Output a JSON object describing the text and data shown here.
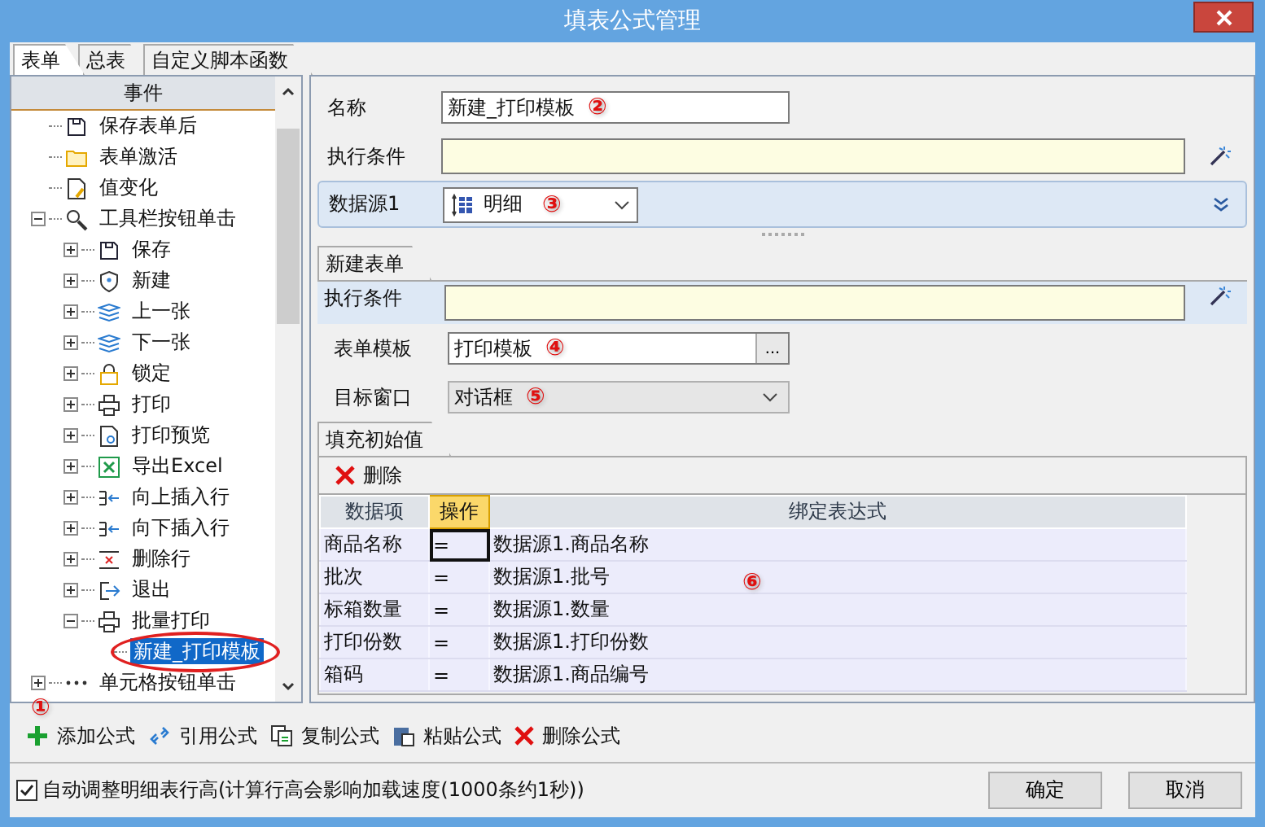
{
  "window": {
    "title": "填表公式管理"
  },
  "tabs": [
    {
      "label": "表单",
      "selected": true
    },
    {
      "label": "总表",
      "selected": false
    },
    {
      "label": "自定义脚本函数",
      "selected": false
    }
  ],
  "tree": {
    "header": "事件",
    "marker": "①",
    "items": [
      {
        "label": "保存表单后",
        "selected": false
      },
      {
        "label": "表单激活",
        "selected": false
      },
      {
        "label": "值变化",
        "selected": false
      },
      {
        "label": "工具栏按钮单击",
        "selected": false,
        "expanded": true,
        "children": [
          {
            "label": "保存",
            "selected": false,
            "expanded": false
          },
          {
            "label": "新建",
            "selected": false,
            "expanded": false
          },
          {
            "label": "上一张",
            "selected": false,
            "expanded": false
          },
          {
            "label": "下一张",
            "selected": false,
            "expanded": false
          },
          {
            "label": "锁定",
            "selected": false,
            "expanded": false
          },
          {
            "label": "打印",
            "selected": false,
            "expanded": false
          },
          {
            "label": "打印预览",
            "selected": false,
            "expanded": false
          },
          {
            "label": "导出Excel",
            "selected": false,
            "expanded": false
          },
          {
            "label": "向上插入行",
            "selected": false,
            "expanded": false
          },
          {
            "label": "向下插入行",
            "selected": false,
            "expanded": false
          },
          {
            "label": "删除行",
            "selected": false,
            "expanded": false
          },
          {
            "label": "退出",
            "selected": false,
            "expanded": false
          },
          {
            "label": "批量打印",
            "selected": false,
            "expanded": true,
            "children": [
              {
                "label": "新建_打印模板",
                "selected": true,
                "circled": true
              }
            ]
          }
        ]
      },
      {
        "label": "单元格按钮单击",
        "selected": false,
        "expanded": false
      }
    ]
  },
  "form": {
    "name": {
      "label": "名称",
      "value": "新建_打印模板",
      "marker": "②"
    },
    "condition": {
      "label": "执行条件"
    },
    "datasource": {
      "label": "数据源1",
      "value": "明细",
      "marker": "③"
    }
  },
  "subtab": {
    "label": "新建表单",
    "condition": {
      "label": "执行条件"
    },
    "template": {
      "label": "表单模板",
      "value": "打印模板",
      "button": "...",
      "marker": "④"
    },
    "target": {
      "label": "目标窗口",
      "value": "对话框",
      "marker": "⑤"
    }
  },
  "fill": {
    "tab": "填充初始值",
    "delete": "删除",
    "marker": "⑥",
    "columns": [
      {
        "label": "数据项",
        "selected": false
      },
      {
        "label": "操作",
        "selected": true
      },
      {
        "label": "绑定表达式",
        "selected": false
      }
    ],
    "rows": [
      [
        "商品名称",
        "=",
        "数据源1.商品名称"
      ],
      [
        "批次",
        "=",
        "数据源1.批号"
      ],
      [
        "标箱数量",
        "=",
        "数据源1.数量"
      ],
      [
        "打印份数",
        "=",
        "数据源1.打印份数"
      ],
      [
        "箱码",
        "=",
        "数据源1.商品编号"
      ]
    ]
  },
  "toolbar": [
    "添加公式",
    "引用公式",
    "复制公式",
    "粘贴公式",
    "删除公式"
  ],
  "auto_height": {
    "label": "自动调整明细表行高(计算行高会影响加载速度(1000条约1秒))",
    "checked": true
  },
  "buttons": [
    "确定",
    "取消"
  ]
}
